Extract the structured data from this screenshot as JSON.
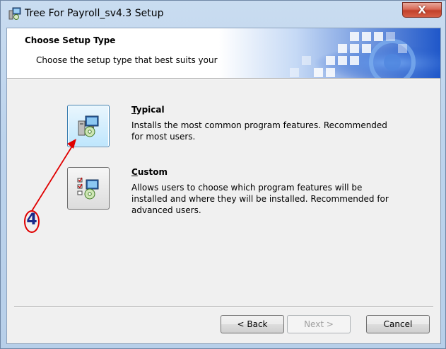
{
  "window": {
    "title": "Tree For Payroll_sv4.3 Setup",
    "close_label": "X"
  },
  "banner": {
    "title": "Choose Setup Type",
    "subtitle": "Choose the setup type that best suits your needs"
  },
  "options": [
    {
      "title_first": "T",
      "title_rest": "ypical",
      "description": "Installs the most common program features. Recommended for most users.",
      "focused": true
    },
    {
      "title_first": "C",
      "title_rest": "ustom",
      "description": "Allows users to choose which program features will be installed and where they will be installed. Recommended for advanced users.",
      "focused": false
    }
  ],
  "buttons": {
    "back": "< Back",
    "next": "Next >",
    "cancel": "Cancel",
    "next_enabled": false
  },
  "annotation": {
    "number": "4",
    "color": "#e00000"
  },
  "colors": {
    "accent": "#3c7fb1",
    "close": "#c2402a"
  }
}
